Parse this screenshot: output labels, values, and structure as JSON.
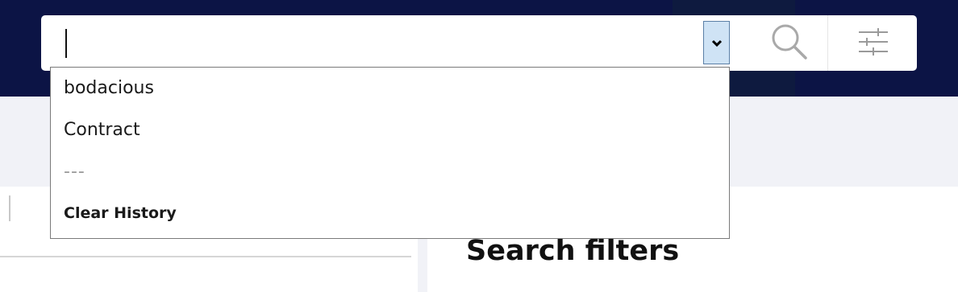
{
  "search": {
    "value": "",
    "placeholder": "",
    "dropdown_icon": "chevron-down-icon",
    "search_icon": "magnifier-icon",
    "filter_icon": "sliders-icon"
  },
  "history": {
    "items": [
      "bodacious",
      "Contract"
    ],
    "separator": "---",
    "clear_label": "Clear History"
  },
  "panel": {
    "filters_title": "Search filters"
  },
  "colors": {
    "header_bg": "#0c1445",
    "subheader_bg": "#f1f2f7",
    "dropdown_toggle_bg": "#cfe3f5"
  }
}
